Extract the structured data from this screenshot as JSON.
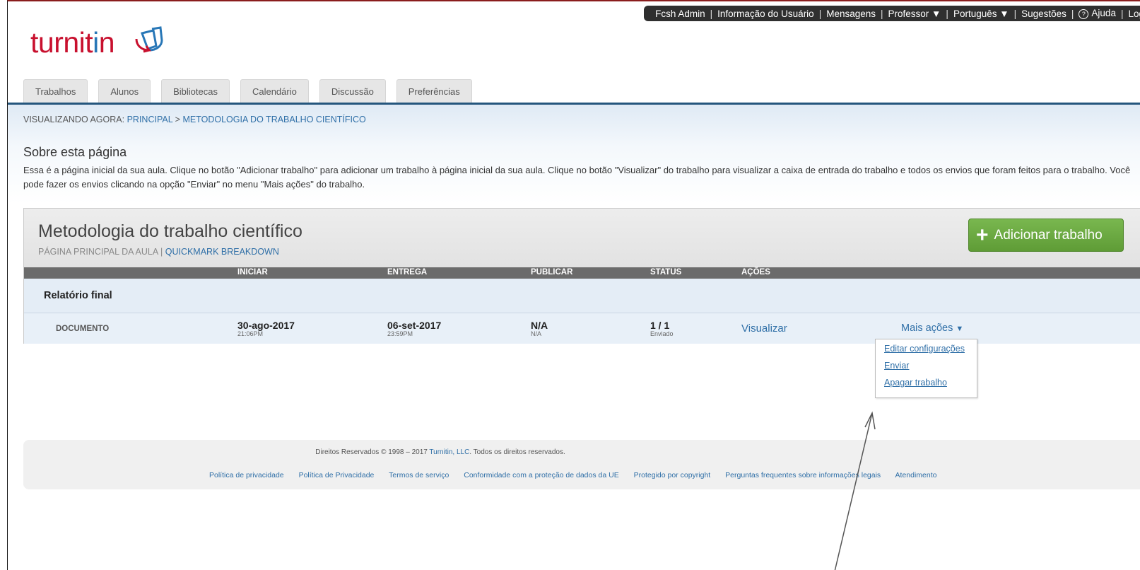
{
  "topbar": {
    "user": "Fcsh Admin",
    "user_info": "Informação do Usuário",
    "messages": "Mensagens",
    "role": "Professor ▼",
    "language": "Português ▼",
    "suggestions": "Sugestões",
    "help": "Ajuda",
    "logout": "Log"
  },
  "logo": {
    "text_main": "turnit",
    "text_i": "i",
    "text_n": "n"
  },
  "tabs": [
    "Trabalhos",
    "Alunos",
    "Bibliotecas",
    "Calendário",
    "Discussão",
    "Preferências"
  ],
  "breadcrumb": {
    "prefix": "VISUALIZANDO AGORA: ",
    "home": "PRINCIPAL",
    "sep": " > ",
    "current": "METODOLOGIA DO TRABALHO CIENTÍFICO"
  },
  "about": {
    "title": "Sobre esta página",
    "text": "Essa é a página inicial da sua aula. Clique no botão \"Adicionar trabalho\" para adicionar um trabalho à página inicial da sua aula. Clique no botão \"Visualizar\" do trabalho para visualizar a caixa de entrada do trabalho e todos os envios que foram feitos para o trabalho. Você pode fazer os envios clicando na opção \"Enviar\" no menu \"Mais ações\" do trabalho."
  },
  "class": {
    "title": "Metodologia do trabalho científico",
    "sub_prefix": "PÁGINA PRINCIPAL DA AULA | ",
    "sub_link": "QUICKMARK BREAKDOWN",
    "add_button": "Adicionar trabalho"
  },
  "columns": {
    "start": "INICIAR",
    "due": "ENTREGA",
    "post": "PUBLICAR",
    "status": "STATUS",
    "actions": "AÇÕES"
  },
  "assignment": {
    "title": "Relatório final",
    "type": "DOCUMENTO",
    "start_date": "30-ago-2017",
    "start_time": "21:06PM",
    "due_date": "06-set-2017",
    "due_time": "23:59PM",
    "post_date": "N/A",
    "post_time": "N/A",
    "status_count": "1 / 1",
    "status_label": "Enviado",
    "view": "Visualizar",
    "more_actions": "Mais ações"
  },
  "dropdown": [
    "Editar configurações",
    "Enviar",
    "Apagar trabalho"
  ],
  "footer": {
    "copyright_prefix": "Direitos Reservados © 1998 – 2017 ",
    "copyright_link": "Turnitin, LLC",
    "copyright_suffix": ". Todos os direitos reservados.",
    "links": [
      "Política de privacidade",
      "Política de Privacidade",
      "Termos de serviço",
      "Conformidade com a proteção de dados da UE",
      "Protegido por copyright",
      "Perguntas frequentes sobre informações legais",
      "Atendimento"
    ]
  },
  "colors": {
    "brand_red": "#c8102e",
    "link_blue": "#2f6fa7",
    "add_green": "#6aaa41",
    "nav_line": "#24567d"
  }
}
